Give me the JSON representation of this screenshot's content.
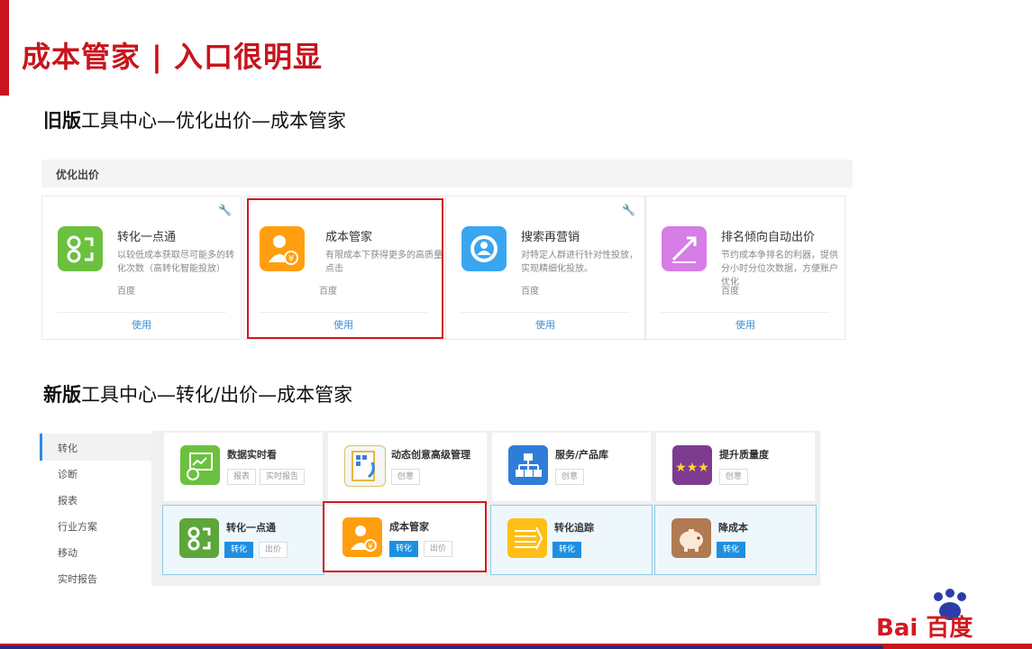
{
  "slide_title": "成本管家 | 入口很明显",
  "old": {
    "heading_lead": "旧版",
    "heading_rest": "工具中心—优化出价—成本管家",
    "panel_title": "优化出价",
    "cards": [
      {
        "name": "转化一点通",
        "desc": "以较低成本获取尽可能多的转化次数（高转化智能投放）",
        "source": "百度",
        "action": "使用",
        "icon": "conversion-icon",
        "color": "#6cc03f"
      },
      {
        "name": "成本管家",
        "desc": "有限成本下获得更多的高质量点击",
        "source": "百度",
        "action": "使用",
        "icon": "cost-manager-icon",
        "color": "#ff9f0f"
      },
      {
        "name": "搜索再营销",
        "desc": "对特定人群进行针对性投放，实现精细化投放。",
        "source": "百度",
        "action": "使用",
        "icon": "remarketing-icon",
        "color": "#3aa6f0"
      },
      {
        "name": "排名倾向自动出价",
        "desc": "节约成本争排名的利器，提供分小时分位次数据，方便账户优化",
        "source": "百度",
        "action": "使用",
        "icon": "ranking-icon",
        "color": "#d77de6"
      }
    ]
  },
  "new": {
    "heading_lead": "新版",
    "heading_rest": "工具中心—转化/出价—成本管家",
    "sidebar": [
      "转化",
      "诊断",
      "报表",
      "行业方案",
      "移动",
      "实时报告"
    ],
    "row1": [
      {
        "name": "数据实时看",
        "tags": [
          "报表",
          "实时报告"
        ],
        "icon": "realtime-data-icon",
        "color": "#6cc03f"
      },
      {
        "name": "动态创意高级管理",
        "tags": [
          "创意"
        ],
        "icon": "dynamic-creative-icon",
        "color": "#f5f5f5"
      },
      {
        "name": "服务/产品库",
        "tags": [
          "创意"
        ],
        "icon": "product-library-icon",
        "color": "#2f7dd8"
      },
      {
        "name": "提升质量度",
        "tags": [
          "创意"
        ],
        "icon": "quality-stars-icon",
        "color": "#7d3b8f"
      }
    ],
    "row2": [
      {
        "name": "转化一点通",
        "tags": [
          "转化",
          "出价"
        ],
        "icon": "conversion-icon",
        "color": "#5ca63a"
      },
      {
        "name": "成本管家",
        "tags": [
          "转化",
          "出价"
        ],
        "icon": "cost-manager-icon",
        "color": "#ff9f0f"
      },
      {
        "name": "转化追踪",
        "tags": [
          "转化"
        ],
        "icon": "conversion-tracking-icon",
        "color": "#ffbf17"
      },
      {
        "name": "降成本",
        "tags": [
          "转化"
        ],
        "icon": "piggy-bank-icon",
        "color": "#b07a52"
      }
    ]
  },
  "logo_text": "Bai 百度"
}
